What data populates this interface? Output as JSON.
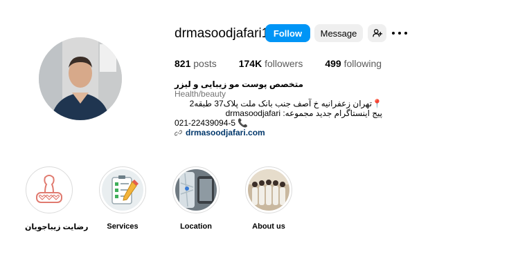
{
  "profile": {
    "username": "drmasoodjafari1",
    "follow_label": "Follow",
    "message_label": "Message",
    "add_user_icon": "add-user-icon",
    "more_icon": "more-options-icon"
  },
  "stats": {
    "posts_count": "821",
    "posts_label": "posts",
    "followers_count": "174K",
    "followers_label": "followers",
    "following_count": "499",
    "following_label": "following"
  },
  "bio": {
    "name": "متخصص پوست مو زیبایی و لیزر",
    "category": "Health/beauty",
    "address": "تهران زعفرانیه خ آصف جنب بانک ملت پلاک37 طبقه2",
    "instagram_note": "پیج اینستاگرام جدید مجموعه: drmasoodjafari",
    "phone": "021-22439094-5",
    "link": "drmasoodjafari.com"
  },
  "highlights": [
    {
      "label": "رضایت زیباجویان"
    },
    {
      "label": "Services"
    },
    {
      "label": "Location"
    },
    {
      "label": "About us"
    }
  ],
  "colors": {
    "follow_button": "#0095f6",
    "secondary_button": "#efefef",
    "link": "#00376b"
  }
}
